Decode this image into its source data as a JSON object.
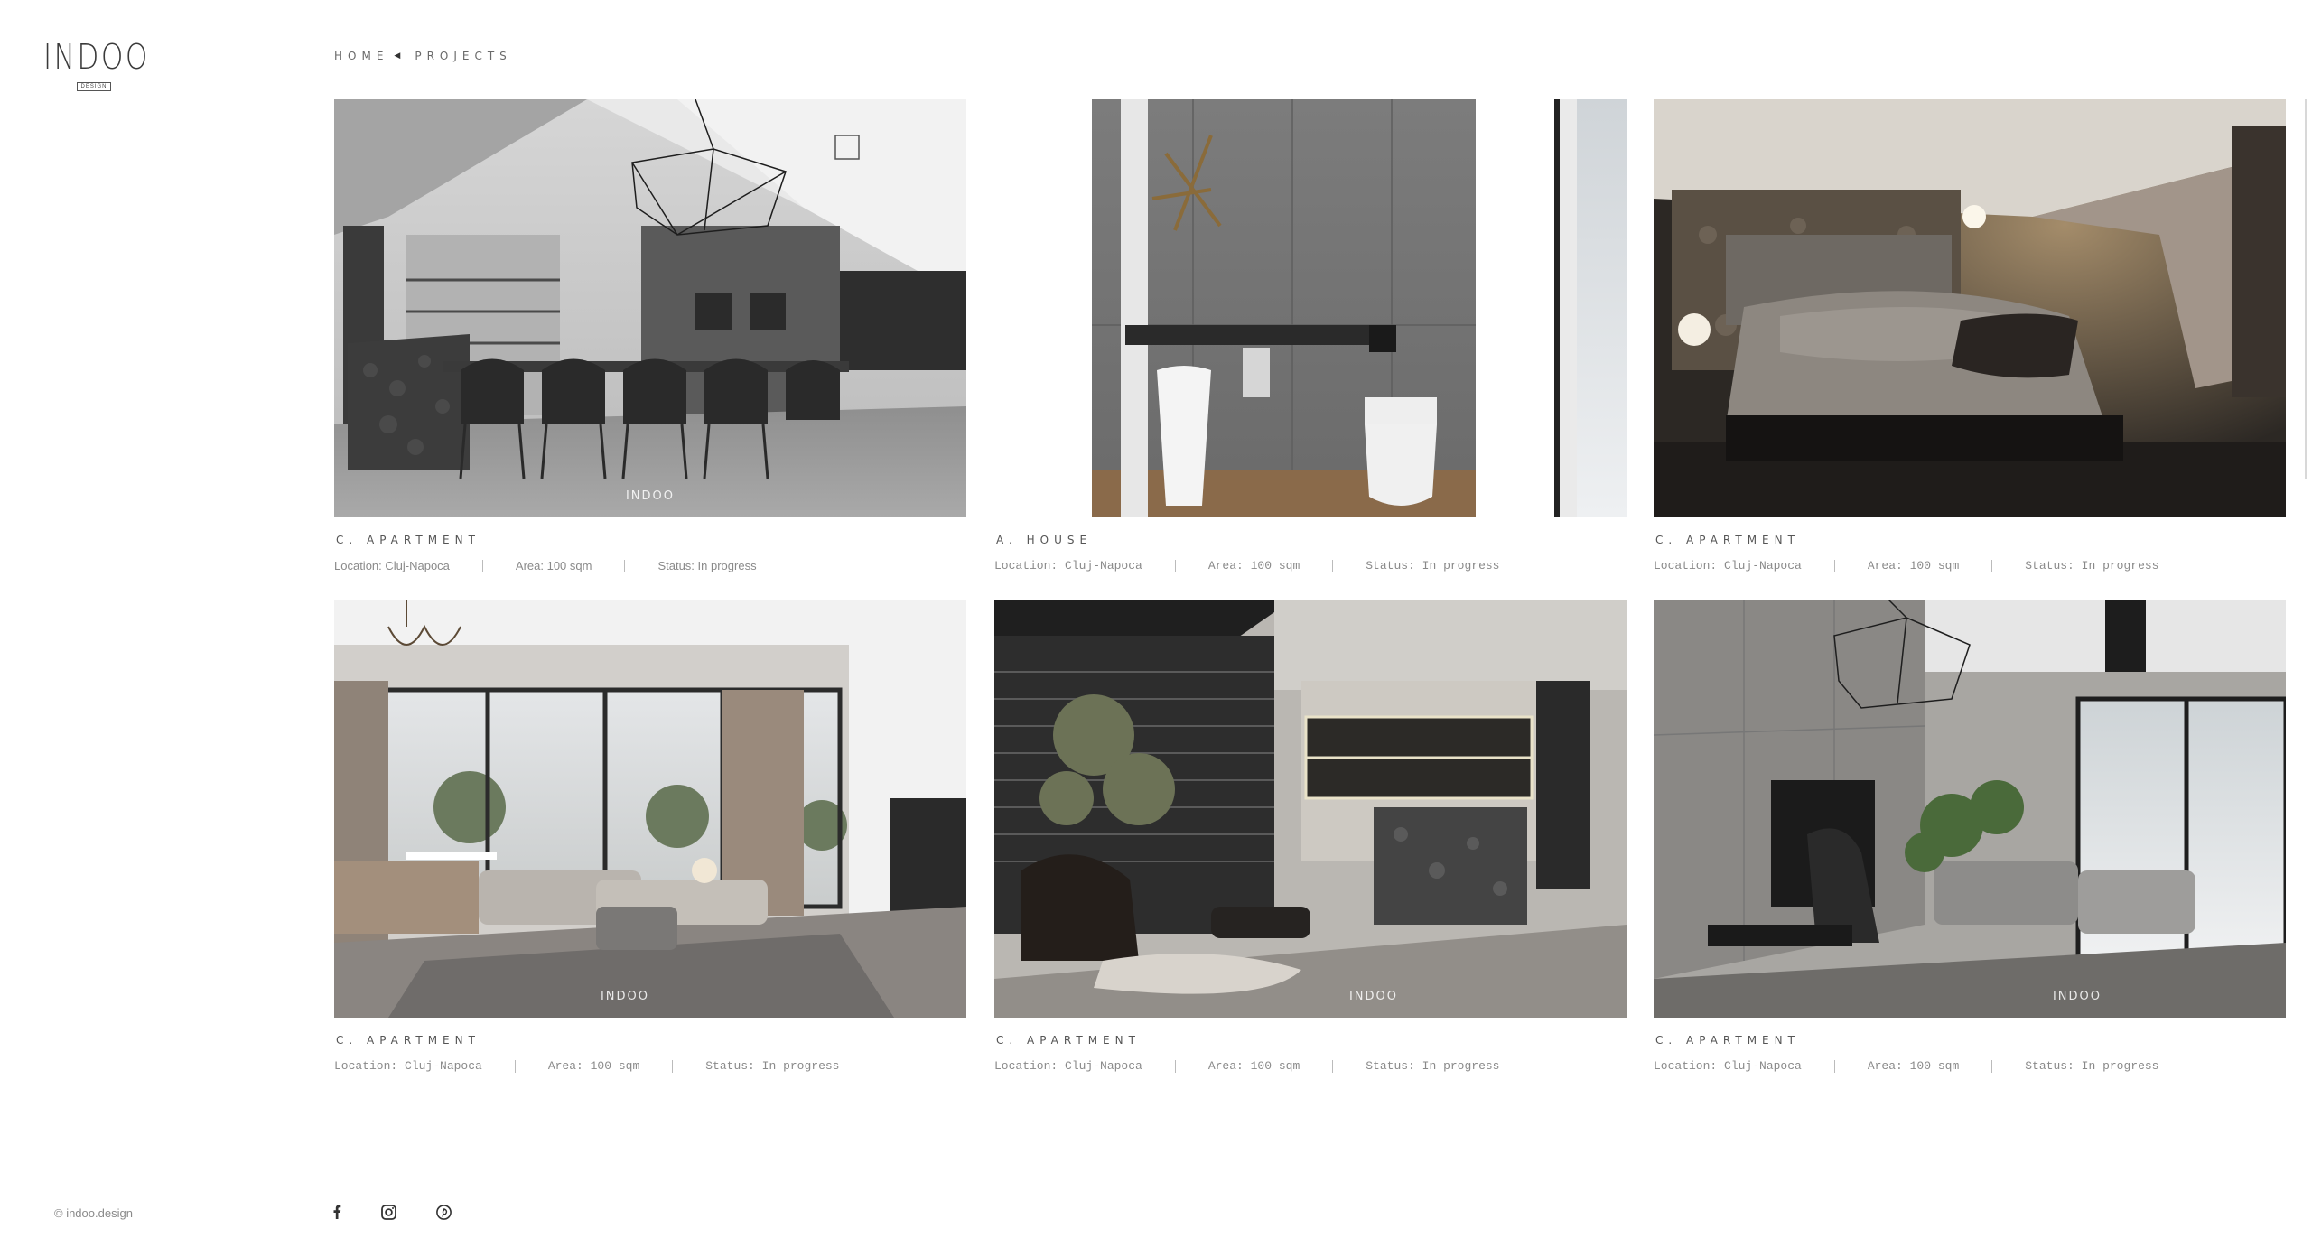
{
  "brand": {
    "logo_text": "INDOO",
    "logo_sub": "DESIGN"
  },
  "breadcrumb": {
    "home": "HOME",
    "current": "PROJECTS"
  },
  "projects": [
    {
      "title": "C. APARTMENT",
      "location": "Location: Cluj-Napoca",
      "area": "Area: 100 sqm",
      "status": "Status: In progress",
      "watermark": "INDOO"
    },
    {
      "title": "A. HOUSE",
      "location": "Location: Cluj-Napoca",
      "area": "Area: 100 sqm",
      "status": "Status: In progress",
      "watermark": ""
    },
    {
      "title": "C. APARTMENT",
      "location": "Location: Cluj-Napoca",
      "area": "Area: 100 sqm",
      "status": "Status: In progress",
      "watermark": ""
    },
    {
      "title": "C. APARTMENT",
      "location": "Location: Cluj-Napoca",
      "area": "Area: 100 sqm",
      "status": "Status: In progress",
      "watermark": "INDOO"
    },
    {
      "title": "C. APARTMENT",
      "location": "Location: Cluj-Napoca",
      "area": "Area: 100 sqm",
      "status": "Status: In progress",
      "watermark": "INDOO"
    },
    {
      "title": "C. APARTMENT",
      "location": "Location: Cluj-Napoca",
      "area": "Area: 100 sqm",
      "status": "Status: In progress",
      "watermark": "INDOO"
    }
  ],
  "footer": {
    "copyright": "© indoo.design",
    "social": [
      "facebook-icon",
      "instagram-icon",
      "pinterest-icon"
    ]
  }
}
